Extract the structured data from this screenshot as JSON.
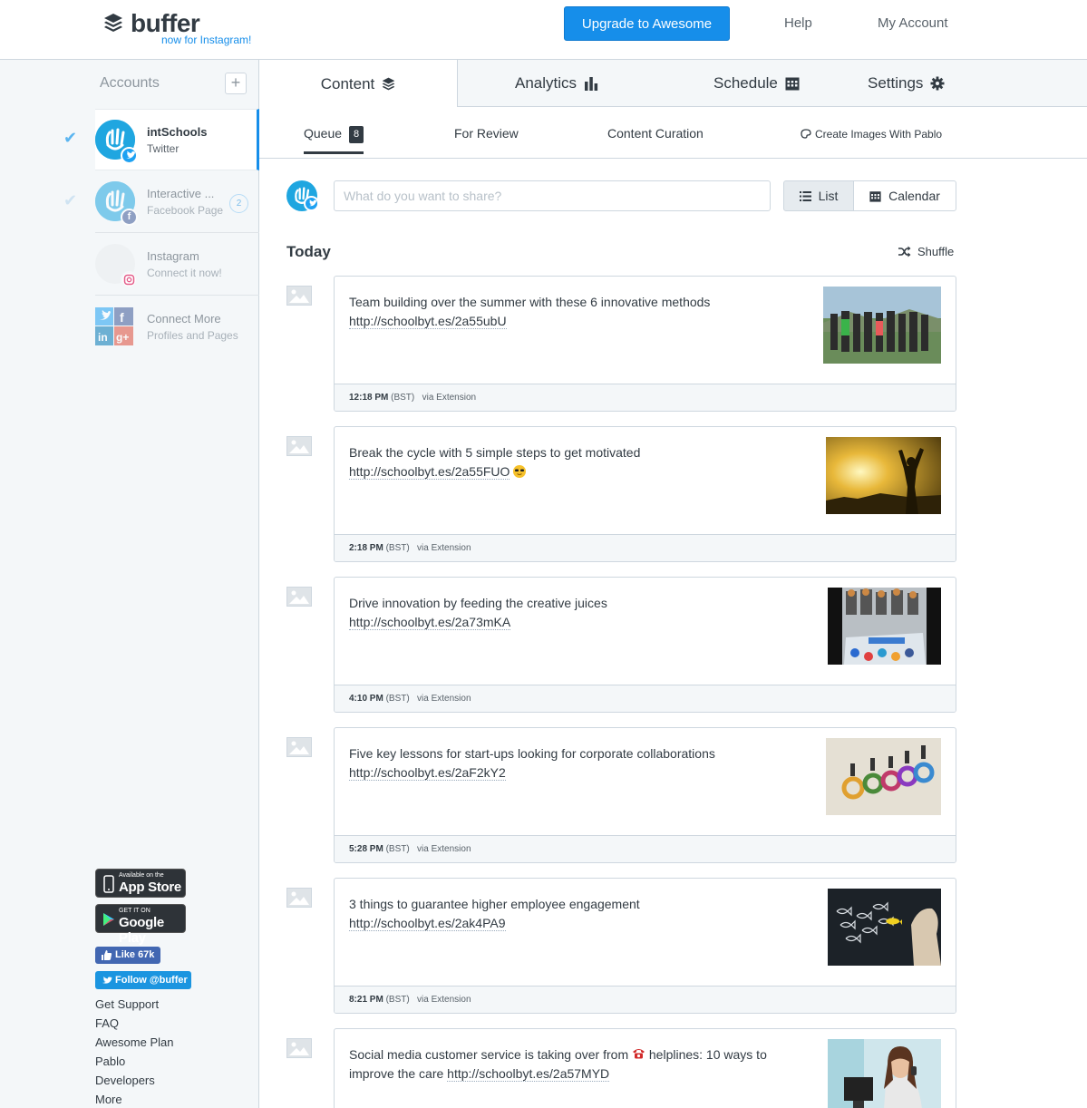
{
  "header": {
    "logo_text": "buffer",
    "logo_tagline": "now for Instagram!",
    "upgrade_label": "Upgrade to Awesome",
    "help_label": "Help",
    "account_label": "My Account"
  },
  "sidebar": {
    "accounts_title": "Accounts",
    "add_label": "+",
    "accounts": [
      {
        "name": "intSchools",
        "type": "Twitter"
      },
      {
        "name": "Interactive ...",
        "type": "Facebook Page",
        "count": "2"
      },
      {
        "name": "Instagram",
        "type": "Connect it now!"
      },
      {
        "name": "Connect More",
        "type": "Profiles and Pages"
      }
    ],
    "app_store": {
      "small": "Available on the",
      "big": "App Store"
    },
    "google_play": {
      "small": "GET IT ON",
      "big": "Google Play"
    },
    "like_label": "Like 67k",
    "follow_label": "Follow @buffer",
    "links": [
      "Get Support",
      "FAQ",
      "Awesome Plan",
      "Pablo",
      "Developers",
      "More"
    ]
  },
  "main_tabs": [
    "Content",
    "Analytics",
    "Schedule",
    "Settings"
  ],
  "sub_tabs": {
    "queue": "Queue",
    "queue_count": "8",
    "review": "For Review",
    "curation": "Content Curation",
    "pablo": "Create Images With Pablo"
  },
  "composer": {
    "placeholder": "What do you want to share?",
    "list_label": "List",
    "calendar_label": "Calendar"
  },
  "queue": {
    "day_label": "Today",
    "shuffle_label": "Shuffle",
    "posts": [
      {
        "text": "Team building over the summer with these 6 innovative methods",
        "url": "http://schoolbyt.es/2a55ubU",
        "time": "12:18 PM",
        "tz": "(BST)",
        "via": "via Extension"
      },
      {
        "text": "Break the cycle with 5 simple steps to get motivated",
        "url": "http://schoolbyt.es/2a55FUO",
        "time": "2:18 PM",
        "tz": "(BST)",
        "via": "via Extension"
      },
      {
        "text": "Drive innovation by feeding the creative juices",
        "url": "http://schoolbyt.es/2a73mKA",
        "time": "4:10 PM",
        "tz": "(BST)",
        "via": "via Extension"
      },
      {
        "text": "Five key lessons for start-ups looking for corporate collaborations",
        "url": "http://schoolbyt.es/2aF2kY2",
        "time": "5:28 PM",
        "tz": "(BST)",
        "via": "via Extension"
      },
      {
        "text": "3 things to guarantee higher employee engagement",
        "url": "http://schoolbyt.es/2ak4PA9",
        "time": "8:21 PM",
        "tz": "(BST)",
        "via": "via Extension"
      },
      {
        "text_a": "Social media customer service is taking over from",
        "text_b": "helplines: 10 ways to improve the care",
        "url": "http://schoolbyt.es/2a57MYD"
      }
    ]
  },
  "colors": {
    "brand_blue": "#168eea",
    "text_dark": "#323b43",
    "border": "#ced7df",
    "sidebar_bg": "#f4f7f9"
  }
}
